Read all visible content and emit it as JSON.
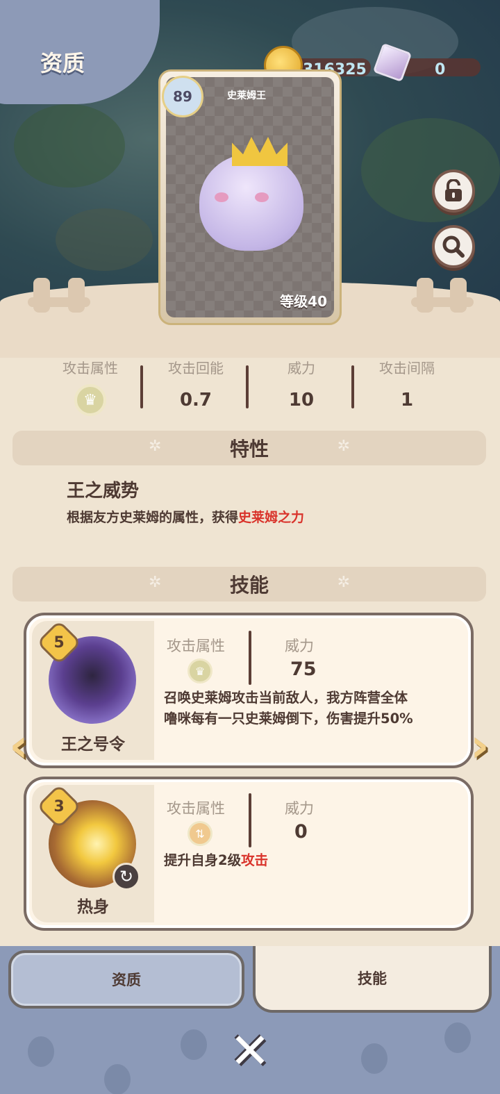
{
  "header": {
    "title": "资质"
  },
  "currency": {
    "coins": "316325",
    "gems": "0"
  },
  "card": {
    "name": "史莱姆王",
    "rank": "89",
    "level_text": "等级40"
  },
  "stats": [
    {
      "label": "攻击属性",
      "value": ""
    },
    {
      "label": "攻击回能",
      "value": "0.7"
    },
    {
      "label": "威力",
      "value": "10"
    },
    {
      "label": "攻击间隔",
      "value": "1"
    }
  ],
  "traits": {
    "section_title": "特性",
    "name": "王之威势",
    "desc_prefix": "根据友方史莱姆的属性，获得",
    "desc_highlight": "史莱姆之力"
  },
  "skills": {
    "section_title": "技能",
    "items": [
      {
        "name": "王之号令",
        "cost": "5",
        "attr_label": "攻击属性",
        "power_label": "威力",
        "power": "75",
        "desc_line1": "召唤史莱姆攻击当前敌人，我方阵营全体",
        "desc_line2": "噜咪每有一只史莱姆倒下，伤害提升50%"
      },
      {
        "name": "热身",
        "cost": "3",
        "attr_label": "攻击属性",
        "power_label": "威力",
        "power": "0",
        "desc_prefix": "提升自身2级",
        "desc_highlight": "攻击"
      }
    ]
  },
  "tabs": {
    "left": "资质",
    "right": "技能"
  },
  "colors": {
    "accent_red": "#d9332b",
    "panel_bg": "#fdf4e7",
    "bottom_bg": "#8c9ab8"
  }
}
